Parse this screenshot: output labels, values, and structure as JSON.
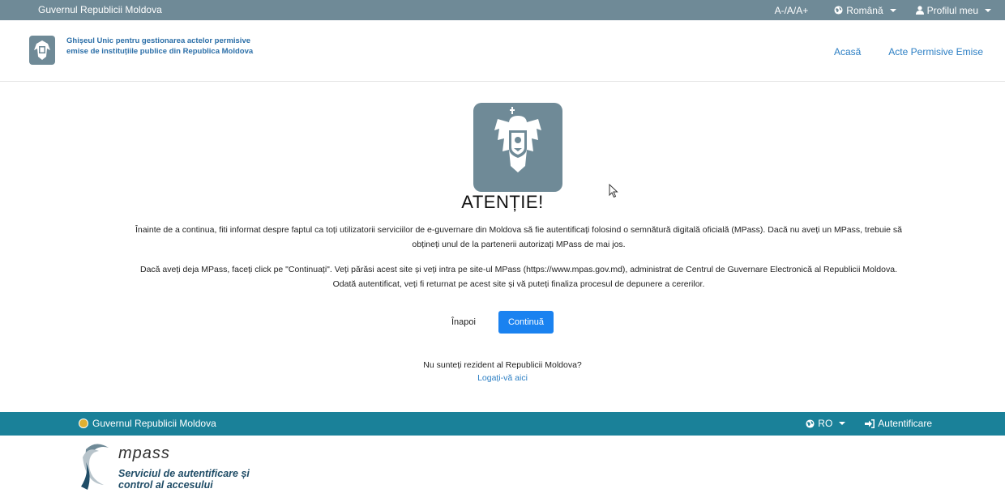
{
  "gov_bar": {
    "title": "Guvernul Republicii Moldova",
    "font_size_control": "A-/A/A+",
    "language": "Română",
    "profile": "Profilul meu"
  },
  "header": {
    "app_name": "Ghișeul Unic pentru gestionarea actelor permisive emise de instituțiile publice din Republica Moldova",
    "nav": [
      {
        "label": "Acasă"
      },
      {
        "label": "Acte Permisive Emise"
      }
    ]
  },
  "main": {
    "title": "ATENȚIE!",
    "paragraph1": "Înainte de a continua, fiti informat despre faptul ca toți utilizatorii serviciilor de e-guvernare din Moldova să fie autentificați folosind o semnătură digitală oficială (MPass). Dacă nu aveți un MPass, trebuie să obțineți unul de la partenerii autorizați MPass de mai jos.",
    "paragraph2": "Dacă aveți deja MPass, faceți click pe \"Continuați\". Veți părăsi acest site și veți intra pe site-ul MPass (https://www.mpas.gov.md), administrat de Centrul de Guvernare Electronică al Republicii Moldova. Odată autentificat, veți fi returnat pe acest site și vă puteți finaliza procesul de depunere a cererilor.",
    "back_label": "Înapoi",
    "continue_label": "Continuă",
    "nonresident_question": "Nu sunteți rezident al Republicii Moldova?",
    "nonresident_link": "Logați-vă aici"
  },
  "mpass_bar": {
    "title": "Guvernul Republicii Moldova",
    "language": "RO",
    "login": "Autentificare"
  },
  "mpass_logo": {
    "brand": "mpass",
    "tagline_line1": "Serviciul de autentificare și",
    "tagline_line2": "control al accesului"
  },
  "colors": {
    "gov_bar": "#6f8a97",
    "link": "#2c7fc4",
    "primary_button": "#1a82f0",
    "mpass_bar": "#1a8199"
  }
}
